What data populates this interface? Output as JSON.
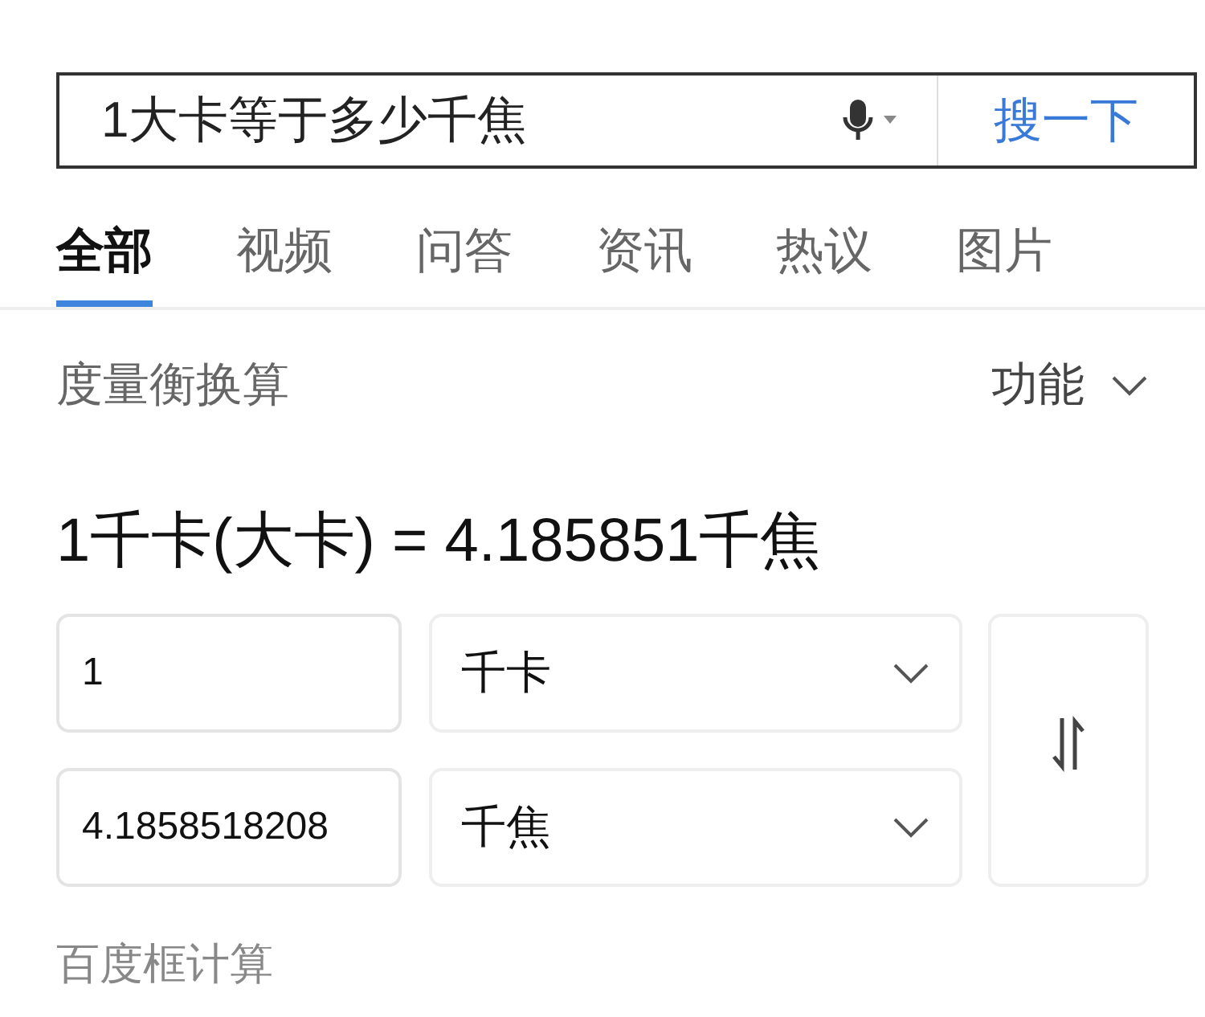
{
  "search": {
    "query": "1大卡等于多少千焦",
    "button": "搜一下"
  },
  "tabs": [
    {
      "label": "全部",
      "selected": true
    },
    {
      "label": "视频",
      "selected": false
    },
    {
      "label": "问答",
      "selected": false
    },
    {
      "label": "资讯",
      "selected": false
    },
    {
      "label": "热议",
      "selected": false
    },
    {
      "label": "图片",
      "selected": false
    }
  ],
  "card": {
    "title": "度量衡换算",
    "menu": "功能",
    "result": "1千卡(大卡) = 4.185851千焦",
    "rows": [
      {
        "value": "1",
        "unit": "千卡"
      },
      {
        "value": "4.1858518208",
        "unit": "千焦"
      }
    ]
  },
  "footer": "百度框计算"
}
